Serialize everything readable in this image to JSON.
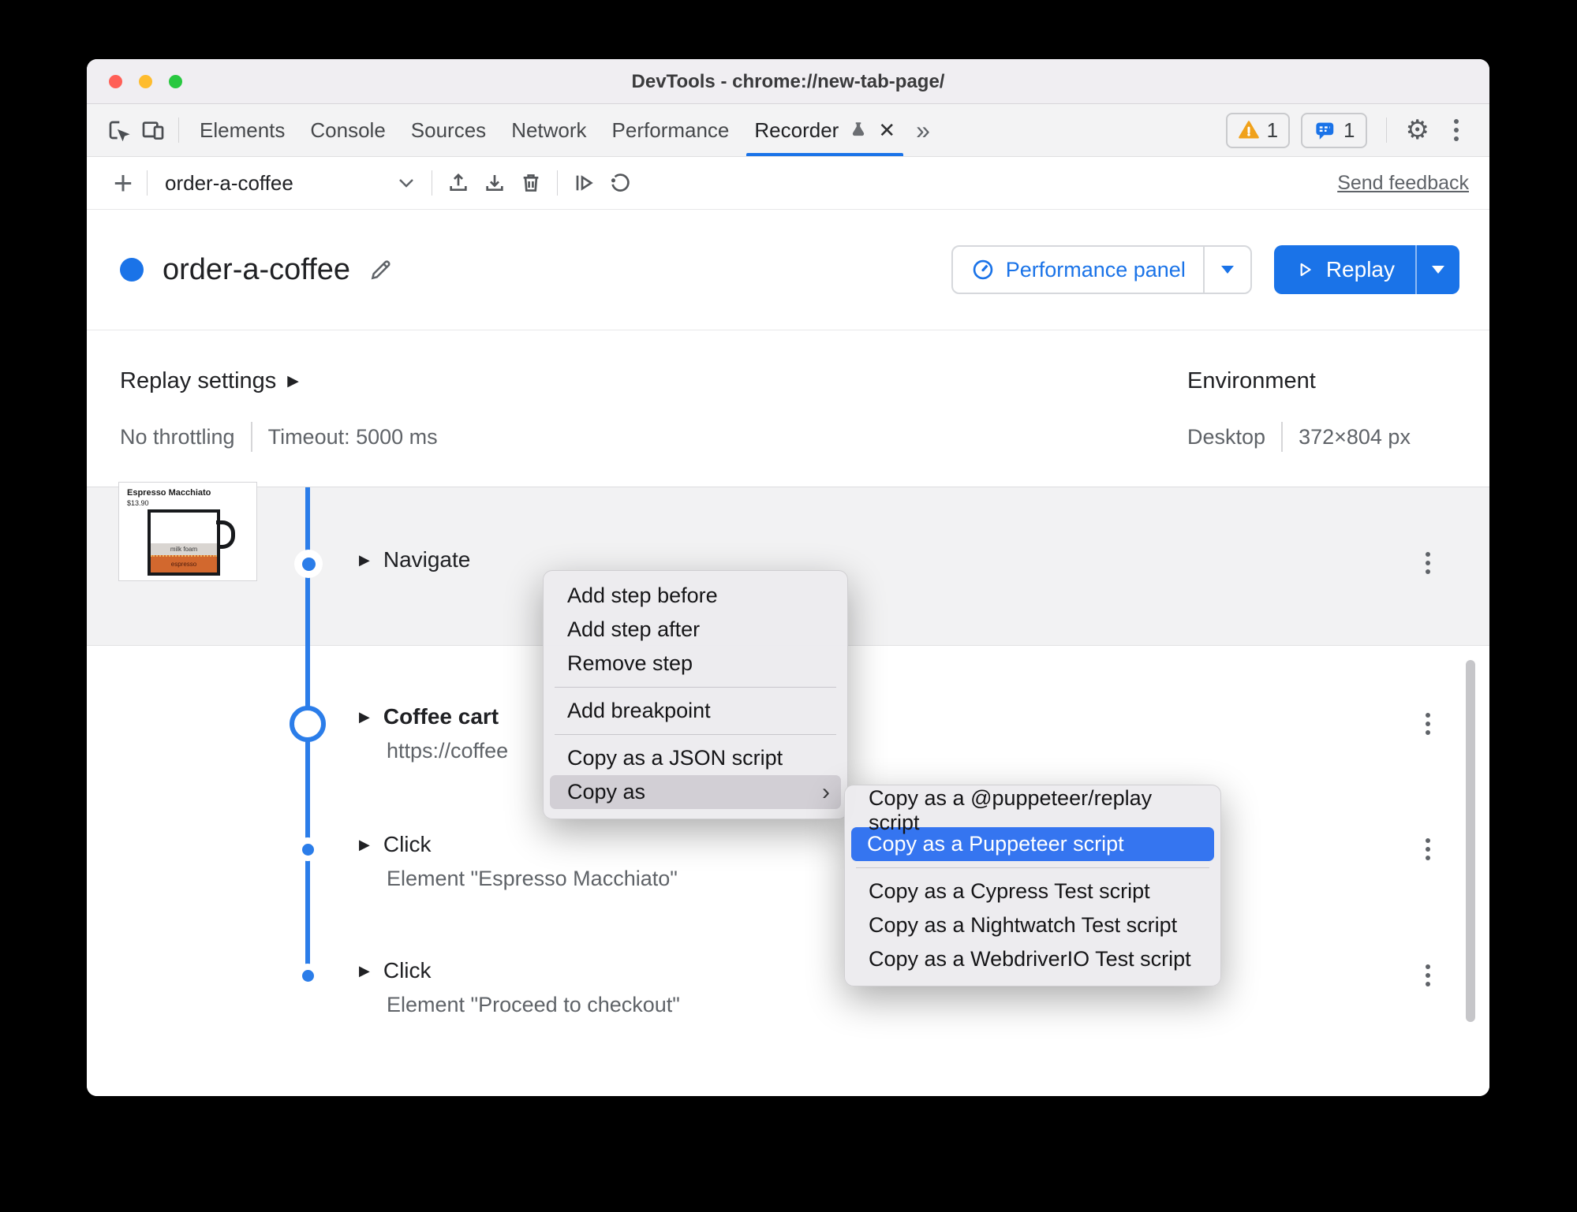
{
  "colors": {
    "accent_blue": "#1a73e8",
    "timeline_blue": "#2b7de9",
    "selection_blue": "#3575f0",
    "traffic_red": "#ff5f57",
    "traffic_yellow": "#febc2e",
    "traffic_green": "#28c840",
    "warning_yellow": "#f0a11a"
  },
  "titlebar": {
    "title": "DevTools - chrome://new-tab-page/"
  },
  "tabbar": {
    "tabs": [
      {
        "label": "Elements"
      },
      {
        "label": "Console"
      },
      {
        "label": "Sources"
      },
      {
        "label": "Network"
      },
      {
        "label": "Performance"
      },
      {
        "label": "Recorder"
      }
    ],
    "warning_count": "1",
    "message_count": "1"
  },
  "icons": {
    "more_tabs": "»",
    "close": "✕",
    "gear": "⚙",
    "plus": "+",
    "disclosure": "▶",
    "settings_arrow": "▶",
    "submenu_arrow": "›"
  },
  "recorder_toolbar": {
    "recording_name": "order-a-coffee",
    "send_feedback": "Send feedback"
  },
  "header": {
    "title": "order-a-coffee",
    "performance_panel": "Performance panel",
    "replay": "Replay"
  },
  "replay_settings": {
    "label": "Replay settings",
    "throttling": "No throttling",
    "timeout": "Timeout: 5000 ms"
  },
  "environment": {
    "label": "Environment",
    "device": "Desktop",
    "viewport": "372×804 px"
  },
  "thumbnail": {
    "product": "Espresso Macchiato",
    "price": "$13.90",
    "layer_top": "milk foam",
    "layer_bottom": "espresso"
  },
  "steps": [
    {
      "title": "Navigate",
      "subtitle": ""
    },
    {
      "title": "Coffee cart",
      "subtitle": "https://coffee"
    },
    {
      "title": "Click",
      "subtitle": "Element \"Espresso Macchiato\""
    },
    {
      "title": "Click",
      "subtitle": "Element \"Proceed to checkout\""
    }
  ],
  "context_menu": {
    "items": [
      "Add step before",
      "Add step after",
      "Remove step",
      "Add breakpoint",
      "Copy as a JSON script",
      "Copy as"
    ]
  },
  "submenu": {
    "items": [
      "Copy as a @puppeteer/replay script",
      "Copy as a Puppeteer script",
      "Copy as a Cypress Test script",
      "Copy as a Nightwatch Test script",
      "Copy as a WebdriverIO Test script"
    ]
  }
}
